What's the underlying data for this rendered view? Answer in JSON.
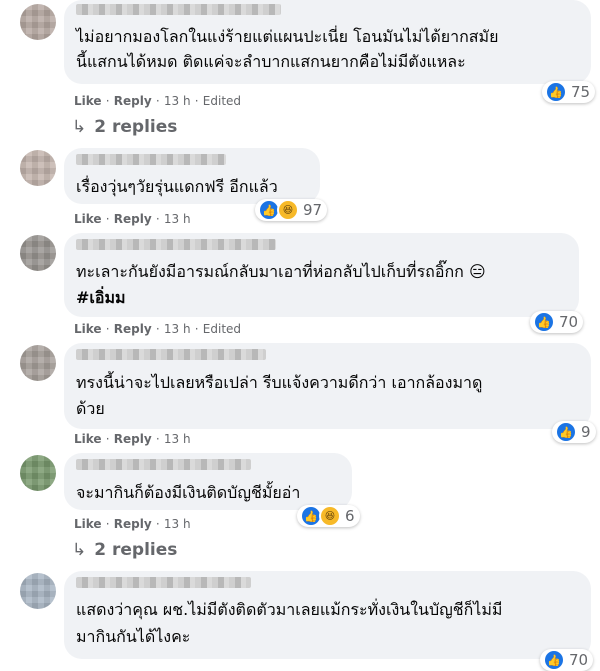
{
  "comments": [
    {
      "lines": [
        "ไม่อยากมองโลกในแง่ร้ายแต่แผนปะเนี่ย โอนมันไม่ได้ยากสมัย",
        "นี้แสกนได้หมด ติดแค่จะลำบากแสกนยากคือไม่มีตังแหละ"
      ],
      "like": "Like",
      "reply": "Reply",
      "time": "13 h",
      "edited": "Edited",
      "reactions": [
        "like"
      ],
      "count": "75",
      "replies": "2 replies"
    },
    {
      "lines": [
        "เรื่องวุ่นๆวัยรุ่นแดกฟรี อีกแล้ว"
      ],
      "like": "Like",
      "reply": "Reply",
      "time": "13 h",
      "reactions": [
        "like",
        "haha"
      ],
      "count": "97"
    },
    {
      "lines": [
        "ทะเลาะกันยังมีอารมณ์กลับมาเอาที่ห่อกลับไปเก็บที่รถอิ๊กก 😑",
        "#เอิ่มม"
      ],
      "like": "Like",
      "reply": "Reply",
      "time": "13 h",
      "edited": "Edited",
      "reactions": [
        "like"
      ],
      "count": "70"
    },
    {
      "lines": [
        "ทรงนี้น่าจะไปเลยหรือเปล่า รีบแจ้งความดีกว่า เอากล้องมาดู",
        "ด้วย"
      ],
      "like": "Like",
      "reply": "Reply",
      "time": "13 h",
      "reactions": [
        "like"
      ],
      "count": "9"
    },
    {
      "lines": [
        "จะมากินก็ต้องมีเงินติดบัญชีมั้ยอ่า"
      ],
      "like": "Like",
      "reply": "Reply",
      "time": "13 h",
      "reactions": [
        "like",
        "haha"
      ],
      "count": "6",
      "replies": "2 replies"
    },
    {
      "lines": [
        "แสดงว่าคุณ ผช.ไม่มีตังติดตัวมาเลยแม้กระทั่งเงินในบัญชีก็ไม่มี",
        "มากินกันได้ไงคะ"
      ],
      "reactions": [
        "like"
      ],
      "count": "70"
    }
  ],
  "icons": {
    "like": "like-reaction-icon",
    "haha": "haha-reaction-icon",
    "reply_arrow": "reply-arrow-icon"
  },
  "colors": {
    "bubble": "#f0f2f5",
    "meta_text": "#65676b",
    "like_blue": "#1b74e4",
    "haha_yellow": "#f7b928"
  }
}
